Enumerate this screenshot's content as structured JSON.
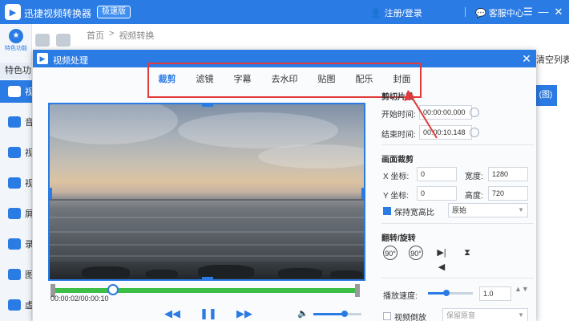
{
  "app": {
    "title": "迅捷视频转换器",
    "badge": "极速版",
    "login": "注册/登录",
    "service": "客服中心",
    "menu_icon": "menu-icon",
    "minimize": "—",
    "close": "✕"
  },
  "sidebar": {
    "top_label": "特色功能",
    "section": "特色功",
    "items": [
      {
        "label": "视",
        "active": true
      },
      {
        "label": "音"
      },
      {
        "label": "视"
      },
      {
        "label": "视"
      },
      {
        "label": "屏"
      },
      {
        "label": "录"
      },
      {
        "label": "图"
      },
      {
        "label": "虚"
      }
    ]
  },
  "toolbar": {
    "labels": [
      "视频转换",
      "视频处理"
    ]
  },
  "breadcrumb": [
    "首页",
    ">",
    "视频转换"
  ],
  "right_strip": "清空列表",
  "right_button": "(图)",
  "dialog": {
    "title": "视频处理",
    "close": "✕",
    "tabs": [
      "裁剪",
      "滤镜",
      "字幕",
      "去水印",
      "贴图",
      "配乐",
      "封面"
    ],
    "active_tab": 0
  },
  "player": {
    "timecode": "00:00:02/00:00:10",
    "prev": "◀◀",
    "play": "❚❚",
    "next": "▶▶",
    "progress_fraction": 0.2,
    "volume_fraction": 0.65
  },
  "panel": {
    "clip_title": "剪切片段",
    "start_label": "开始时间:",
    "start_value": "00:00:00.000",
    "end_label": "结束时间:",
    "end_value": "00:00:10.148",
    "crop_title": "画面裁剪",
    "x_label": "X 坐标:",
    "x_value": "0",
    "width_label": "宽度:",
    "width_value": "1280",
    "y_label": "Y 坐标:",
    "y_value": "0",
    "height_label": "高度:",
    "height_value": "720",
    "keep_ratio_label": "保持宽高比",
    "ratio_value": "原始",
    "flip_title": "翻转/旋转",
    "rotate_left": "90°",
    "rotate_right": "90°",
    "speed_label": "播放速度:",
    "speed_value": "1.0",
    "reverse_label": "视频倒放",
    "audio_option": "保留原音"
  },
  "colors": {
    "accent": "#2a7be4",
    "annotation": "#e03a3a",
    "timeline": "#3cbf47"
  }
}
